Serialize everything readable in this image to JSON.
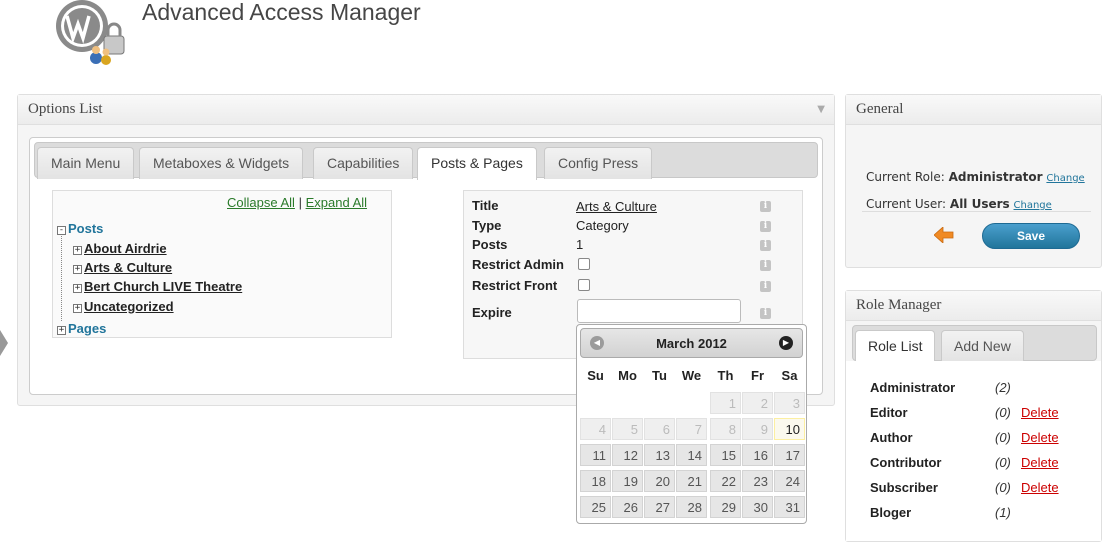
{
  "app": {
    "title": "Advanced Access Manager"
  },
  "options": {
    "title": "Options List",
    "tabs": [
      "Main Menu",
      "Metaboxes & Widgets",
      "Capabilities",
      "Posts & Pages",
      "Config Press"
    ],
    "active_tab": "Posts & Pages",
    "tree": {
      "collapse_all": "Collapse All",
      "separator": "|",
      "expand_all": "Expand All",
      "roots": [
        {
          "label": "Posts",
          "children": [
            "About Airdrie",
            "Arts & Culture",
            "Bert Church LIVE Theatre",
            "Uncategorized"
          ]
        },
        {
          "label": "Pages",
          "children": []
        }
      ]
    },
    "properties": {
      "title_label": "Title",
      "title_value": "Arts & Culture",
      "type_label": "Type",
      "type_value": "Category",
      "posts_label": "Posts",
      "posts_value": "1",
      "restrict_admin_label": "Restrict Admin",
      "restrict_front_label": "Restrict Front",
      "expire_label": "Expire",
      "info_glyph": "i"
    }
  },
  "calendar": {
    "month_label": "March 2012",
    "weekdays": [
      "Su",
      "Mo",
      "Tu",
      "We",
      "Th",
      "Fr",
      "Sa"
    ],
    "rows": [
      [
        "",
        "",
        "",
        "",
        "1",
        "2",
        "3"
      ],
      [
        "4",
        "5",
        "6",
        "7",
        "8",
        "9",
        "10"
      ],
      [
        "11",
        "12",
        "13",
        "14",
        "15",
        "16",
        "17"
      ],
      [
        "18",
        "19",
        "20",
        "21",
        "22",
        "23",
        "24"
      ],
      [
        "25",
        "26",
        "27",
        "28",
        "29",
        "30",
        "31"
      ]
    ],
    "muted_days": [
      "1",
      "2",
      "3",
      "4",
      "5",
      "6",
      "7",
      "8",
      "9"
    ],
    "today": "10",
    "prev_icon": "circle-arrow-left-icon",
    "next_icon": "circle-arrow-right-icon"
  },
  "general": {
    "title": "General",
    "current_role_label": "Current Role:",
    "current_role_value": "Administrator",
    "current_user_label": "Current User:",
    "current_user_value": "All Users",
    "change_label": "Change",
    "save_label": "Save",
    "back_icon": "orange-back-arrow-icon"
  },
  "role_manager": {
    "title": "Role Manager",
    "tabs": [
      "Role List",
      "Add New"
    ],
    "roles": [
      {
        "name": "Administrator",
        "count": "(2)",
        "delete": ""
      },
      {
        "name": "Editor",
        "count": "(0)",
        "delete": "Delete"
      },
      {
        "name": "Author",
        "count": "(0)",
        "delete": "Delete"
      },
      {
        "name": "Contributor",
        "count": "(0)",
        "delete": "Delete"
      },
      {
        "name": "Subscriber",
        "count": "(0)",
        "delete": "Delete"
      },
      {
        "name": "Bloger",
        "count": "(1)",
        "delete": ""
      }
    ]
  },
  "colors": {
    "link_blue": "#21759b",
    "delete_red": "#cc0000",
    "save_blue": "#21759b",
    "tree_link_green": "#2a7a2a"
  }
}
